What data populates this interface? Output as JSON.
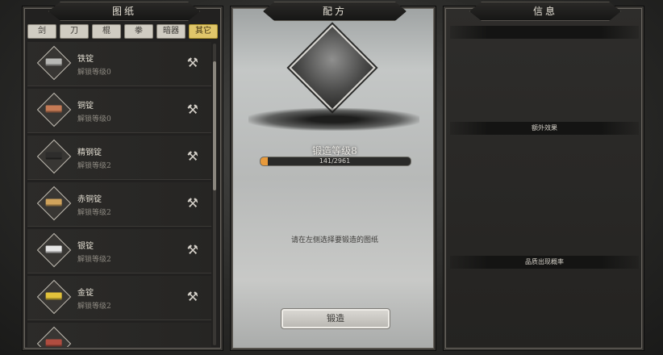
{
  "left_panel": {
    "title": "图纸",
    "tabs": [
      "剑",
      "刀",
      "棍",
      "拳",
      "暗器",
      "其它"
    ],
    "active_tab_index": 5,
    "items": [
      {
        "name": "铁锭",
        "sub": "解锁等级0",
        "color": "#b7b7b4",
        "icon": "hammer-icon"
      },
      {
        "name": "铜锭",
        "sub": "解锁等级0",
        "color": "#c47a55",
        "icon": "hammer-icon"
      },
      {
        "name": "精钢锭",
        "sub": "解锁等级2",
        "color": "#2e2d2c",
        "icon": "hammer-icon"
      },
      {
        "name": "赤铜锭",
        "sub": "解锁等级2",
        "color": "#d0a35c",
        "icon": "hammer-icon"
      },
      {
        "name": "银锭",
        "sub": "解锁等级2",
        "color": "#e6e6e6",
        "icon": "hammer-icon"
      },
      {
        "name": "金锭",
        "sub": "解锁等级2",
        "color": "#e2c23b",
        "icon": "hammer-icon"
      }
    ]
  },
  "middle_panel": {
    "title": "配方",
    "level_text": "锻造等级8",
    "progress": {
      "current": 141,
      "max": 2961,
      "label": "141/2961",
      "fill_color": "#e79a3c"
    },
    "hint": "请在左侧选择要锻造的图纸",
    "forge_button": "锻造"
  },
  "right_panel": {
    "title": "信息",
    "section_top": "",
    "section_extra": "额外效果",
    "section_quality": "品质出现概率"
  }
}
